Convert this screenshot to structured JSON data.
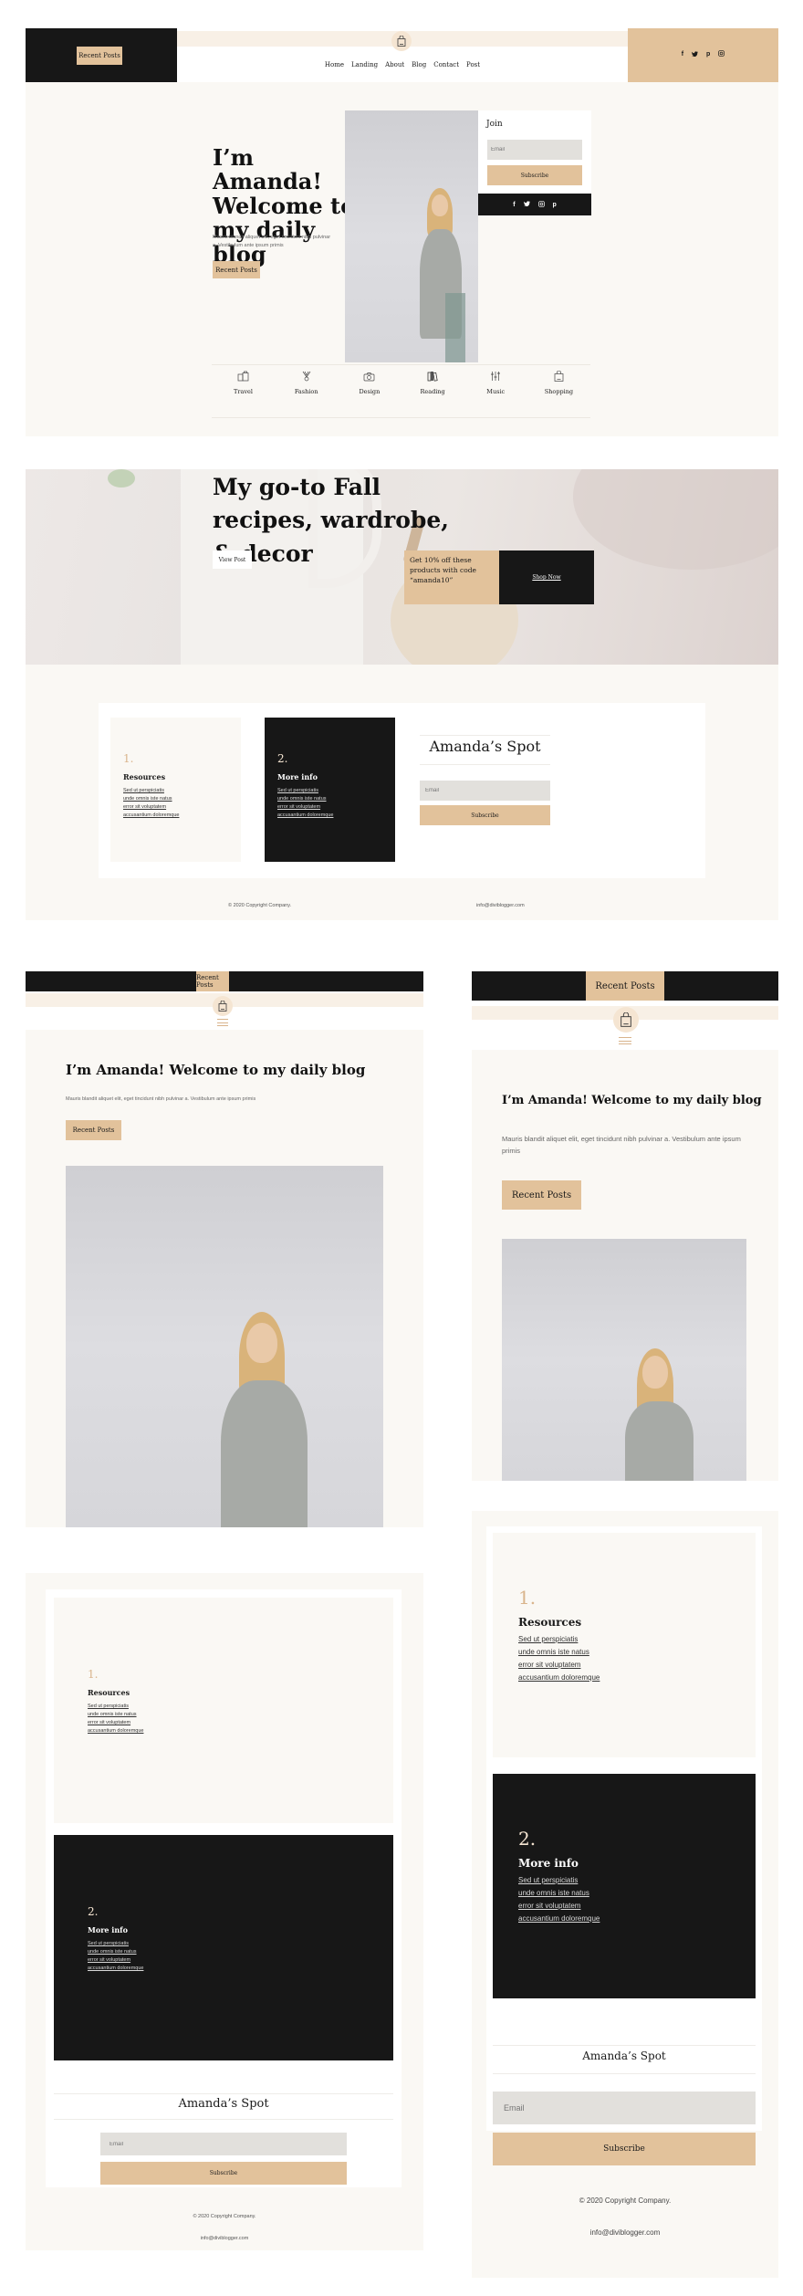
{
  "colors": {
    "accent_tan": "#e2c29b",
    "dark": "#171717",
    "cream": "#faf8f4",
    "input_gray": "#e2e0dc"
  },
  "desktop": {
    "header": {
      "recent_posts_button": "Recent Posts",
      "logo_icon": "shopping-bag-icon",
      "nav": [
        "Home",
        "Landing",
        "About",
        "Blog",
        "Contact",
        "Post"
      ],
      "socials": [
        "f",
        "🐦",
        "p",
        "◎"
      ],
      "social_names": [
        "facebook",
        "twitter",
        "pinterest",
        "instagram"
      ]
    },
    "hero": {
      "title": "I’m Amanda! Welcome to my daily blog",
      "text": "Mauris blandit aliquet elit, eget tincidunt nibh pulvinar a. Vestibulum ante ipsum primis",
      "button": "Recent Posts",
      "join": {
        "title": "Join",
        "email_placeholder": "Email",
        "subscribe": "Subscribe",
        "socials": [
          "f",
          "🐦",
          "◎",
          "p"
        ]
      },
      "categories": [
        {
          "label": "Travel",
          "icon": "luggage-icon"
        },
        {
          "label": "Fashion",
          "icon": "hanger-icon"
        },
        {
          "label": "Design",
          "icon": "camera-icon"
        },
        {
          "label": "Reading",
          "icon": "books-icon"
        },
        {
          "label": "Music",
          "icon": "equalizer-icon"
        },
        {
          "label": "Shopping",
          "icon": "shopping-bag-icon"
        }
      ]
    },
    "banner": {
      "title": "My go-to Fall recipes, wardrobe, & decor",
      "button": "View Post",
      "promo": "Get 10% off these products with code “amanda10”",
      "shop": "Shop Now"
    },
    "footer": {
      "col1": {
        "num": "1.",
        "title": "Resources",
        "links": [
          "Sed ut perspiciatis",
          "unde omnis iste natus",
          "error sit voluptatem",
          "accusantium doloremque"
        ]
      },
      "col2": {
        "num": "2.",
        "title": "More info",
        "links": [
          "Sed ut perspiciatis",
          "unde omnis iste natus",
          "error sit voluptatem",
          "accusantium doloremque"
        ]
      },
      "spot": {
        "title": "Amanda’s Spot",
        "email_placeholder": "Email",
        "subscribe": "Subscribe"
      },
      "copyright": "© 2020 Copyright Company.",
      "email": "info@diviblogger.com"
    }
  },
  "tablet": {
    "recent_posts_button": "Recent Posts",
    "title": "I’m Amanda! Welcome to my daily blog",
    "text": "Mauris blandit aliquet elit, eget tincidunt nibh pulvinar a. Vestibulum ante ipsum primis",
    "button": "Recent Posts",
    "col1": {
      "num": "1.",
      "title": "Resources",
      "links": [
        "Sed ut perspiciatis",
        "unde omnis iste natus",
        "error sit voluptatem",
        "accusantium doloremque"
      ]
    },
    "col2": {
      "num": "2.",
      "title": "More info",
      "links": [
        "Sed ut perspiciatis",
        "unde omnis iste natus",
        "error sit voluptatem",
        "accusantium doloremque"
      ]
    },
    "spot": {
      "title": "Amanda’s Spot",
      "email_placeholder": "Email",
      "subscribe": "Subscribe"
    },
    "copyright": "© 2020 Copyright Company.",
    "email": "info@diviblogger.com"
  },
  "mobile": {
    "recent_posts_button": "Recent Posts",
    "title": "I’m Amanda! Welcome to my daily blog",
    "text": "Mauris blandit aliquet elit, eget tincidunt nibh pulvinar a. Vestibulum ante ipsum primis",
    "button": "Recent Posts",
    "col1": {
      "num": "1.",
      "title": "Resources",
      "links": [
        "Sed ut perspiciatis",
        "unde omnis iste natus",
        "error sit voluptatem",
        "accusantium doloremque"
      ]
    },
    "col2": {
      "num": "2.",
      "title": "More info",
      "links": [
        "Sed ut perspiciatis",
        "unde omnis iste natus",
        "error sit voluptatem",
        "accusantium doloremque"
      ]
    },
    "spot": {
      "title": "Amanda’s Spot",
      "email_placeholder": "Email",
      "subscribe": "Subscribe"
    },
    "copyright": "© 2020 Copyright Company.",
    "email": "info@diviblogger.com"
  }
}
